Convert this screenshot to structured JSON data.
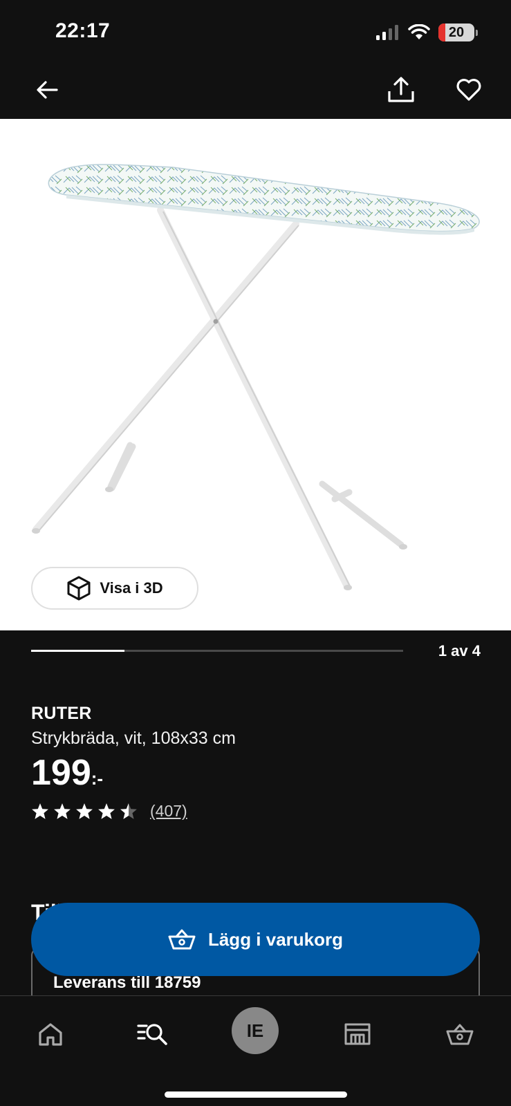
{
  "status_bar": {
    "time": "22:17",
    "battery": "20"
  },
  "top_bar": {
    "back_icon": "arrow-left-icon",
    "share_icon": "share-icon",
    "favorite_icon": "heart-icon"
  },
  "gallery": {
    "visa_3d_label": "Visa i 3D",
    "pager_text": "1 av 4",
    "current": 1,
    "total": 4
  },
  "product": {
    "brand": "RUTER",
    "description": "Strykbräda, vit, 108x33 cm",
    "price": "199",
    "price_suffix": ":-",
    "rating": 4.5,
    "rating_max": 5,
    "review_count": "(407)"
  },
  "availability": {
    "section_title_partial": "Till",
    "delivery_text": "Leverans till 18759"
  },
  "cart": {
    "add_label": "Lägg i varukorg",
    "icon": "basket-icon"
  },
  "bottom_nav": {
    "items": [
      "home-icon",
      "search-list-icon",
      "ie-avatar",
      "store-icon",
      "basket-icon"
    ],
    "avatar_initials": "IE"
  },
  "colors": {
    "background": "#111111",
    "primary_button": "#0058a3",
    "battery_low": "#e5322d"
  }
}
